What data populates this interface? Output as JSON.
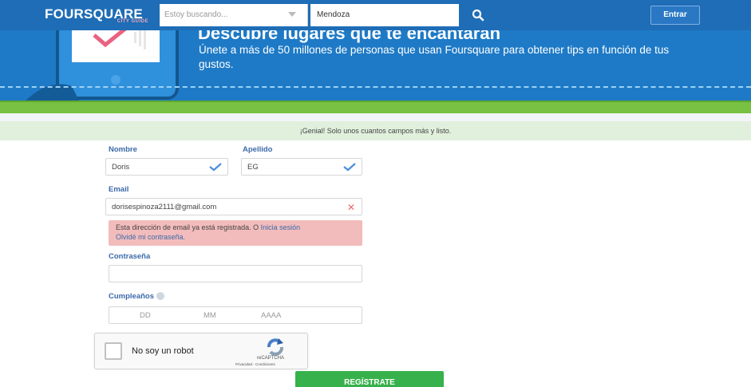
{
  "header": {
    "logo": "FOURSQUARE",
    "logo_sub": "CITY GUIDE",
    "search_placeholder": "Estoy buscando...",
    "location_value": "Mendoza",
    "login_label": "Entrar",
    "search_icon": "search-icon"
  },
  "hero": {
    "heading": "Descubre lugares que te encantarán",
    "subtitle": "Únete a más de 50 millones de personas que usan Foursquare para obtener tips en función de tus gustos."
  },
  "notice": "¡Genial! Solo unos cuantos campos más y listo.",
  "form": {
    "first_name_label": "Nombre",
    "first_name_value": "Doris",
    "last_name_label": "Apellido",
    "last_name_value": "EG",
    "email_label": "Email",
    "email_value": "dorisespinoza2111@gmail.com",
    "error_text": "Esta dirección de email ya está registrada. O",
    "error_link_login": "Inicia sesión",
    "error_link_forgot": "Olvidé mi contraseña.",
    "password_label": "Contraseña",
    "password_value": "",
    "birthday_label": "Cumpleaños",
    "birthday_day": "DD",
    "birthday_month": "MM",
    "birthday_year": "AAAA"
  },
  "captcha": {
    "label": "No soy un robot",
    "brand": "reCAPTCHA",
    "terms": "Privacidad - Condiciones"
  },
  "register_label": "REGÍSTRATE",
  "colors": {
    "brand_blue": "#1e6db6",
    "hero_blue": "#1e7ac6",
    "accent_green": "#79c142",
    "label_blue": "#3b6aa9",
    "error_bg": "#f3bcbc",
    "notice_bg": "#e1f0dd",
    "register_green": "#37b14b"
  }
}
